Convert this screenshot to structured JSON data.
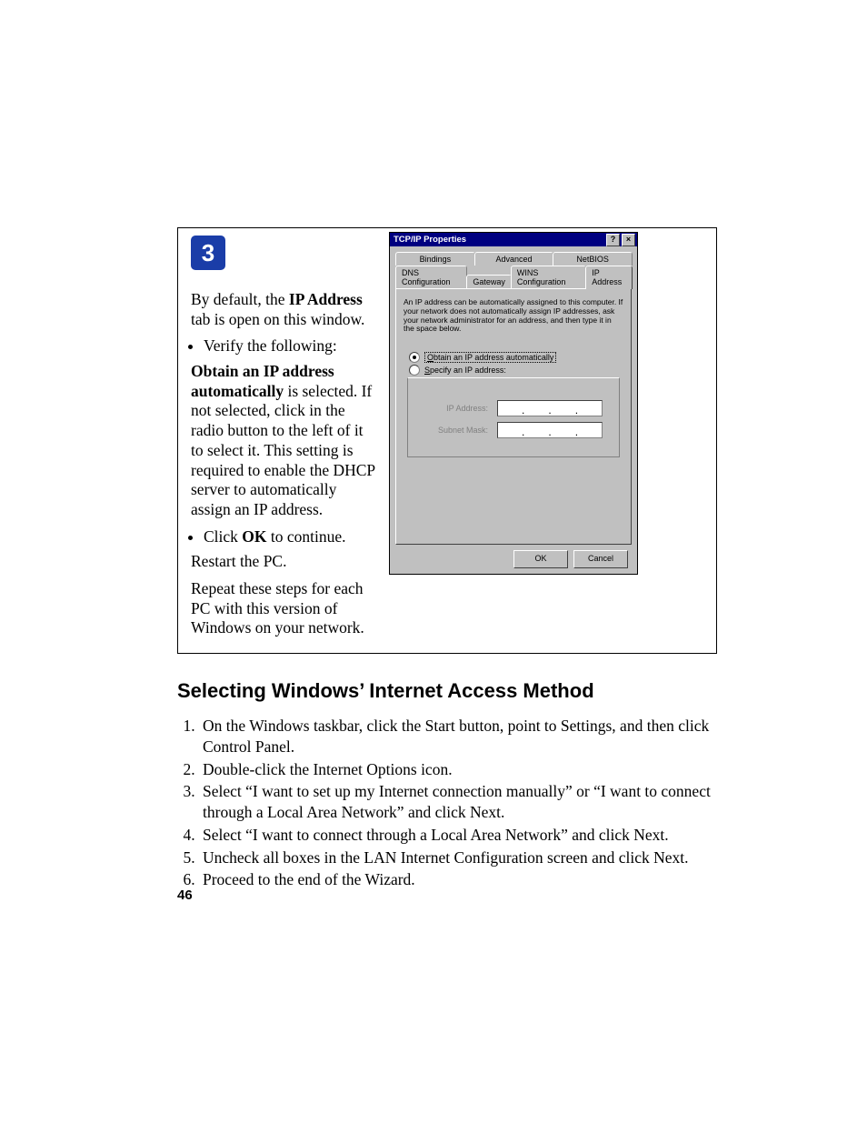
{
  "step_number": "3",
  "left": {
    "p1_pre": "By default, the ",
    "p1_bold": "IP Address",
    "p1_post": " tab is open on this window.",
    "bullet1": "Verify the following:",
    "indent_bold": "Obtain an IP address automatically",
    "indent_rest": " is selected. If not selected, click in the radio button to the left of it to select it.  This setting is required to enable the DHCP server to automatically assign an IP address.",
    "bullet2_pre": "Click ",
    "bullet2_bold": "OK",
    "bullet2_post": " to continue.",
    "p2": "Restart the PC.",
    "p3": "Repeat these steps for each PC with this version of Windows on your network."
  },
  "dialog": {
    "title": "TCP/IP Properties",
    "help_glyph": "?",
    "close_glyph": "×",
    "tabs_row1": [
      "Bindings",
      "Advanced",
      "NetBIOS"
    ],
    "tabs_row2": [
      "DNS Configuration",
      "Gateway",
      "WINS Configuration",
      "IP Address"
    ],
    "active_tab": "IP Address",
    "description": "An IP address can be automatically assigned to this computer. If your network does not automatically assign IP addresses, ask your network administrator for an address, and then type it in the space below.",
    "radio_auto": "Obtain an IP address automatically",
    "radio_specify": "Specify an IP address:",
    "field_ip": "IP Address:",
    "field_mask": "Subnet Mask:",
    "ok": "OK",
    "cancel": "Cancel"
  },
  "section": {
    "heading": "Selecting Windows’ Internet Access Method",
    "items": [
      "On the Windows taskbar, click the Start button, point to Settings, and then click Control Panel.",
      "Double-click the Internet Options icon.",
      "Select “I want to set up my Internet connection manually” or “I want to connect through a Local Area Network” and click Next.",
      "Select “I want to connect through a Local Area Network” and click Next.",
      "Uncheck all boxes in the LAN Internet Configuration screen and click Next.",
      "Proceed to the end of the Wizard."
    ]
  },
  "page_number": "46"
}
